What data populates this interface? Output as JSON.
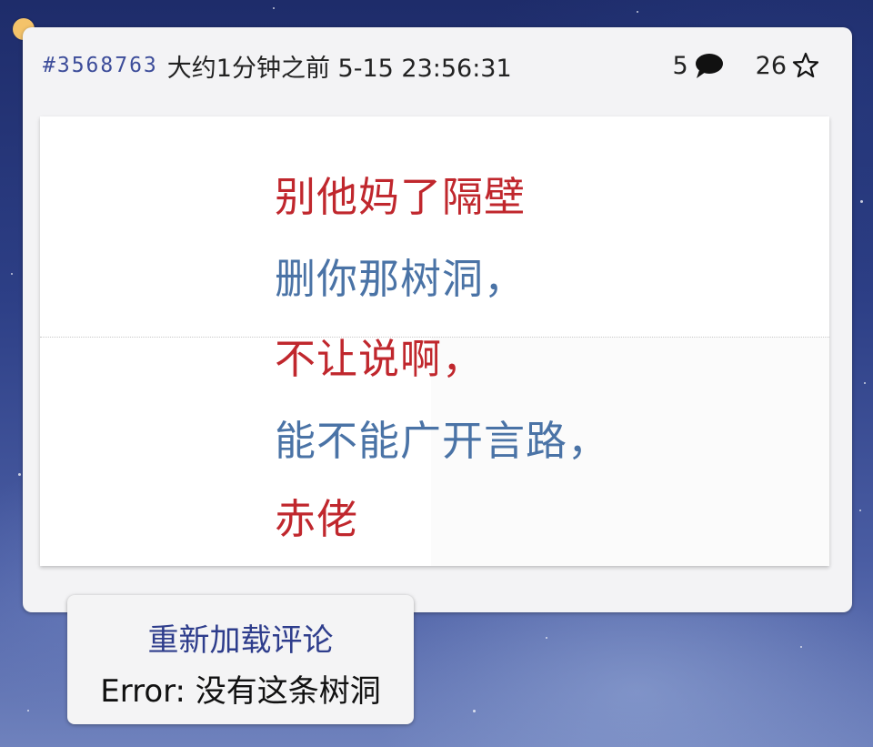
{
  "post": {
    "pid": "#3568763",
    "time": "大约1分钟之前 5-15 23:56:31",
    "reply_count": "5",
    "like_count": "26",
    "reply_icon": "speech-bubble-icon",
    "like_icon": "star-icon"
  },
  "image_text": {
    "lines": [
      {
        "text": "别他妈了隔壁",
        "color": "#c0272d"
      },
      {
        "text": "删你那树洞，",
        "color": "#4a73a6"
      },
      {
        "text": "不让说啊，",
        "color": "#c0272d"
      },
      {
        "text": "能不能广开言路，",
        "color": "#4a73a6"
      },
      {
        "text": "赤佬",
        "color": "#c0272d"
      }
    ]
  },
  "comments": {
    "reload_label": "重新加载评论",
    "error_text": "Error: 没有这条树洞"
  },
  "colors": {
    "accent": "#3d4d9a",
    "dot": "#f4c36a"
  }
}
